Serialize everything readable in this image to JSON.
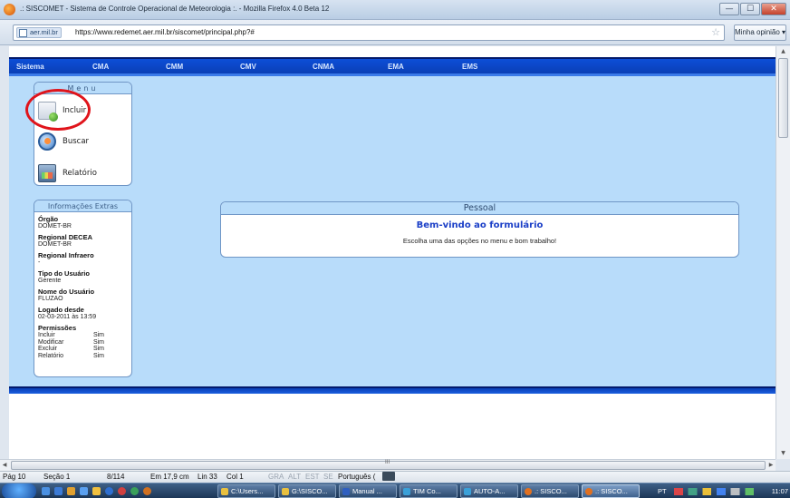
{
  "window": {
    "title": ".: SISCOMET - Sistema de Controle Operacional de Meteorologia :. - Mozilla Firefox 4.0 Beta 12",
    "minimize": "—",
    "maximize": "☐",
    "close": "✕"
  },
  "addressbar": {
    "site_identity": "aer.mil.br",
    "url": "https://www.redemet.aer.mil.br/siscomet/principal.php?#",
    "feedback_button": "Minha opinião ▾"
  },
  "menubar": {
    "items": [
      "Sistema",
      "CMA",
      "CMM",
      "CMV",
      "CNMA",
      "EMA",
      "EMS"
    ]
  },
  "menu_panel": {
    "title": "Menu",
    "items": [
      {
        "label": "Incluir",
        "icon": "add-document-icon"
      },
      {
        "label": "Buscar",
        "icon": "search-icon"
      },
      {
        "label": "Relatório",
        "icon": "report-icon"
      }
    ]
  },
  "info_panel": {
    "title": "Informações Extras",
    "fields": [
      {
        "label": "Órgão",
        "value": "DOMET-BR"
      },
      {
        "label": "Regional DECEA",
        "value": "DOMET-BR"
      },
      {
        "label": "Regional Infraero",
        "value": "-"
      },
      {
        "label": "Tipo do Usuário",
        "value": "Gerente"
      },
      {
        "label": "Nome do Usuário",
        "value": "FLUZAO"
      },
      {
        "label": "Logado desde",
        "value": "02-03-2011 às 13:59"
      }
    ],
    "permissions_label": "Permissões",
    "permissions": [
      {
        "name": "Incluir",
        "value": "Sim"
      },
      {
        "name": "Modificar",
        "value": "Sim"
      },
      {
        "name": "Excluir",
        "value": "Sim"
      },
      {
        "name": "Relatório",
        "value": "Sim"
      }
    ]
  },
  "welcome_box": {
    "header": "Pessoal",
    "title": "Bem-vindo ao formulário",
    "text": "Escolha uma das opções no menu e bom trabalho!"
  },
  "statusbar": {
    "page": "Pág 10",
    "section": "Seção 1",
    "pages": "8/114",
    "position": "Em 17,9 cm",
    "line": "Lin 33",
    "column": "Col 1",
    "modes": [
      "GRA",
      "ALT",
      "EST",
      "SE"
    ],
    "language": "Português (",
    "hscroll_grip": "III"
  },
  "taskbar": {
    "tasks": [
      {
        "label": "C:\\Users..."
      },
      {
        "label": "G:\\SISCO..."
      },
      {
        "label": "Manual ..."
      },
      {
        "label": "TIM Co..."
      },
      {
        "label": "AUTO-A..."
      },
      {
        "label": ".: SISCO..."
      },
      {
        "label": ".: SISCO..."
      }
    ],
    "language": "PT",
    "clock": "11:07"
  },
  "colors": {
    "menubar": "#0d4fd8",
    "content_bg": "#b8dcfa",
    "annotation_circle": "#e0141b",
    "welcome_title": "#1b3fc7"
  }
}
